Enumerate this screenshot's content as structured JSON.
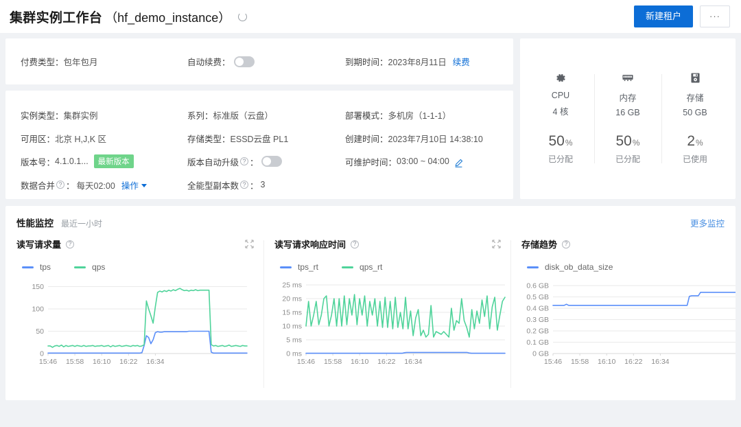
{
  "header": {
    "title": "集群实例工作台",
    "instance": "（hf_demo_instance）",
    "refresh_icon": "refresh-icon",
    "primary_button": "新建租户",
    "more_button": "···"
  },
  "billing": {
    "pay_type_label": "付费类型：",
    "pay_type_value": "包年包月",
    "auto_renew_label": "自动续费：",
    "auto_renew_on": false,
    "expire_label": "到期时间：",
    "expire_value": "2023年8月11日",
    "renew_link": "续费"
  },
  "detail": {
    "rows": [
      [
        {
          "label": "实例类型：",
          "value": "集群实例"
        },
        {
          "label": "系列：",
          "value": "标准版（云盘）"
        },
        {
          "label": "部署模式：",
          "value": "多机房（1-1-1）"
        }
      ],
      [
        {
          "label": "可用区：",
          "value": "北京 H,J,K 区"
        },
        {
          "label": "存储类型：",
          "value": "ESSD云盘 PL1"
        },
        {
          "label": "创建时间：",
          "value": "2023年7月10日 14:38:10"
        }
      ],
      [
        {
          "label": "版本号：",
          "value": "4.1.0.1...",
          "badge": "最新版本"
        },
        {
          "label": "版本自动升级",
          "help": true,
          "value": "",
          "toggle": false
        },
        {
          "label": "可维护时间：",
          "value": "03:00 ~ 04:00",
          "edit": true
        }
      ],
      [
        {
          "label": "数据合并",
          "help": true,
          "value": "每天02:00",
          "action": "操作"
        },
        {
          "label": "全能型副本数",
          "help": true,
          "value": "3"
        },
        {
          "label": "",
          "value": ""
        }
      ]
    ],
    "colon": "："
  },
  "resources": [
    {
      "icon": "cpu-gear-icon",
      "glyph": "✿",
      "name": "CPU",
      "spec": "4 核",
      "percent": "50",
      "unit": "%",
      "state": "已分配"
    },
    {
      "icon": "memory-chip-icon",
      "glyph": "▤",
      "name": "内存",
      "spec": "16 GB",
      "percent": "50",
      "unit": "%",
      "state": "已分配"
    },
    {
      "icon": "storage-disk-icon",
      "glyph": "▣",
      "name": "存储",
      "spec": "50 GB",
      "percent": "2",
      "unit": "%",
      "state": "已使用"
    }
  ],
  "monitor": {
    "title": "性能监控",
    "subtitle": "最近一小时",
    "more_link": "更多监控"
  },
  "colors": {
    "brand_blue": "#0c6dd6",
    "line_blue": "#5b8ff9",
    "line_green": "#4fd39a",
    "badge_green": "#6fd48a",
    "link_blue": "#4a90e2",
    "page_bg": "#f0f2f5"
  },
  "chart_data": [
    {
      "type": "line",
      "title": "读写请求量",
      "help": true,
      "xlabel": "",
      "ylabel": "",
      "ylim": [
        0,
        160
      ],
      "yticks": [
        "0",
        "50",
        "100",
        "150"
      ],
      "ytick_values": [
        0,
        50,
        100,
        150
      ],
      "xticks": [
        "15:46",
        "15:58",
        "16:10",
        "16:22",
        "16:34"
      ],
      "grid": true,
      "legend_position": "top-left",
      "series": [
        {
          "name": "tps",
          "color": "#5b8ff9",
          "values": [
            1,
            1,
            1,
            1,
            1,
            1,
            1,
            1,
            1,
            1,
            1,
            1,
            1,
            1,
            1,
            1,
            1,
            1,
            1,
            1,
            1,
            1,
            1,
            1,
            1,
            1,
            1,
            1,
            1,
            1,
            1,
            1,
            1,
            1,
            1,
            1,
            1,
            1,
            1,
            1,
            1,
            1,
            2,
            18,
            40,
            36,
            22,
            31,
            47,
            49,
            48,
            48,
            49,
            49,
            49,
            49,
            49,
            49,
            49,
            49,
            49,
            49,
            49,
            50,
            50,
            50,
            50,
            50,
            50,
            50,
            50,
            50,
            50,
            3,
            1,
            1,
            1,
            1,
            1,
            1,
            1,
            1,
            1,
            1,
            1,
            1,
            1,
            1,
            1,
            1
          ]
        },
        {
          "name": "qps",
          "color": "#4fd39a",
          "values": [
            17,
            17,
            14,
            17,
            18,
            16,
            19,
            15,
            18,
            16,
            17,
            18,
            16,
            18,
            17,
            16,
            18,
            16,
            17,
            17,
            18,
            16,
            17,
            17,
            18,
            16,
            17,
            18,
            15,
            18,
            16,
            17,
            18,
            16,
            17,
            18,
            17,
            16,
            18,
            17,
            18,
            16,
            17,
            20,
            118,
            100,
            85,
            68,
            105,
            137,
            140,
            138,
            141,
            139,
            142,
            140,
            143,
            141,
            144,
            146,
            143,
            141,
            142,
            140,
            142,
            141,
            143,
            141,
            142,
            142,
            142,
            142,
            142,
            20,
            17,
            18,
            16,
            17,
            18,
            16,
            17,
            19,
            16,
            17,
            18,
            17,
            16,
            18,
            17,
            17
          ]
        }
      ]
    },
    {
      "type": "line",
      "title": "读写请求响应时间",
      "help": true,
      "xlabel": "",
      "ylabel": "",
      "ylim": [
        0,
        26
      ],
      "yticks": [
        "0 ms",
        "5 ms",
        "10 ms",
        "15 ms",
        "20 ms",
        "25 ms"
      ],
      "ytick_values": [
        0,
        5,
        10,
        15,
        20,
        25
      ],
      "xticks": [
        "15:46",
        "15:58",
        "16:10",
        "16:22",
        "16:34"
      ],
      "grid": true,
      "legend_position": "top-left",
      "series": [
        {
          "name": "tps_rt",
          "color": "#5b8ff9",
          "values": [
            0.1,
            0.1,
            0.1,
            0.1,
            0.1,
            0.1,
            0.1,
            0.1,
            0.1,
            0.1,
            0.1,
            0.1,
            0.1,
            0.1,
            0.1,
            0.1,
            0.1,
            0.1,
            0.1,
            0.1,
            0.1,
            0.1,
            0.1,
            0.1,
            0.1,
            0.1,
            0.1,
            0.1,
            0.1,
            0.1,
            0.1,
            0.1,
            0.1,
            0.1,
            0.1,
            0.1,
            0.1,
            0.1,
            0.1,
            0.1,
            0.1,
            0.1,
            0.1,
            0.1,
            0.3,
            0.4,
            0.4,
            0.4,
            0.4,
            0.4,
            0.4,
            0.4,
            0.4,
            0.4,
            0.4,
            0.4,
            0.4,
            0.4,
            0.4,
            0.4,
            0.4,
            0.4,
            0.4,
            0.4,
            0.4,
            0.4,
            0.4,
            0.4,
            0.4,
            0.4,
            0.4,
            0.4,
            0.4,
            0.2,
            0.1,
            0.1,
            0.1,
            0.1,
            0.1,
            0.1,
            0.1,
            0.1,
            0.1,
            0.1,
            0.1,
            0.1,
            0.1,
            0.1,
            0.1,
            0.1
          ]
        },
        {
          "name": "qps_rt",
          "color": "#4fd39a",
          "values": [
            10,
            19,
            10,
            14,
            19,
            10.5,
            14,
            20,
            21,
            10,
            14,
            20,
            10,
            20,
            10,
            21,
            10.5,
            20,
            14,
            21.5,
            10.5,
            20,
            14,
            21,
            10,
            19,
            14,
            20,
            10,
            19,
            9.5,
            20.5,
            9.5,
            19,
            9,
            20.5,
            9.5,
            15,
            9,
            20.5,
            9,
            15.5,
            6.5,
            13,
            16,
            6.5,
            8.5,
            6,
            7,
            17.5,
            6,
            8,
            7.5,
            7,
            8,
            7,
            6,
            16.5,
            8.5,
            12,
            11,
            20,
            12,
            9.5,
            6,
            16,
            9,
            15.5,
            11,
            19.5,
            13.5,
            21,
            9,
            17,
            20.5,
            8.5,
            14,
            19,
            20.5
          ]
        }
      ]
    },
    {
      "type": "line",
      "title": "存储趋势",
      "help": true,
      "xlabel": "",
      "ylabel": "",
      "ylim": [
        0,
        0.63
      ],
      "yticks": [
        "0 GB",
        "0.1 GB",
        "0.2 GB",
        "0.3 GB",
        "0.4 GB",
        "0.5 GB",
        "0.6 GB"
      ],
      "ytick_values": [
        0,
        0.1,
        0.2,
        0.3,
        0.4,
        0.5,
        0.6
      ],
      "xticks": [
        "15:46",
        "15:58",
        "16:10",
        "16:22",
        "16:34"
      ],
      "grid": true,
      "legend_position": "top-left",
      "series": [
        {
          "name": "disk_ob_data_size",
          "color": "#5b8ff9",
          "values": [
            0.425,
            0.425,
            0.425,
            0.425,
            0.425,
            0.425,
            0.435,
            0.425,
            0.425,
            0.425,
            0.425,
            0.425,
            0.425,
            0.425,
            0.425,
            0.425,
            0.425,
            0.425,
            0.425,
            0.425,
            0.425,
            0.425,
            0.425,
            0.425,
            0.425,
            0.425,
            0.425,
            0.425,
            0.425,
            0.425,
            0.425,
            0.425,
            0.425,
            0.425,
            0.425,
            0.425,
            0.425,
            0.425,
            0.425,
            0.425,
            0.425,
            0.425,
            0.425,
            0.425,
            0.425,
            0.425,
            0.425,
            0.425,
            0.425,
            0.425,
            0.425,
            0.425,
            0.425,
            0.425,
            0.425,
            0.425,
            0.425,
            0.425,
            0.425,
            0.425,
            0.425,
            0.505,
            0.51,
            0.51,
            0.51,
            0.51,
            0.54,
            0.54,
            0.54,
            0.54,
            0.54,
            0.54,
            0.54,
            0.54,
            0.54,
            0.54,
            0.54,
            0.54,
            0.54,
            0.54,
            0.54,
            0.54,
            0.54,
            0.545,
            0.57,
            0.57,
            0.57,
            0.57,
            0.57,
            0.57
          ]
        }
      ]
    }
  ]
}
